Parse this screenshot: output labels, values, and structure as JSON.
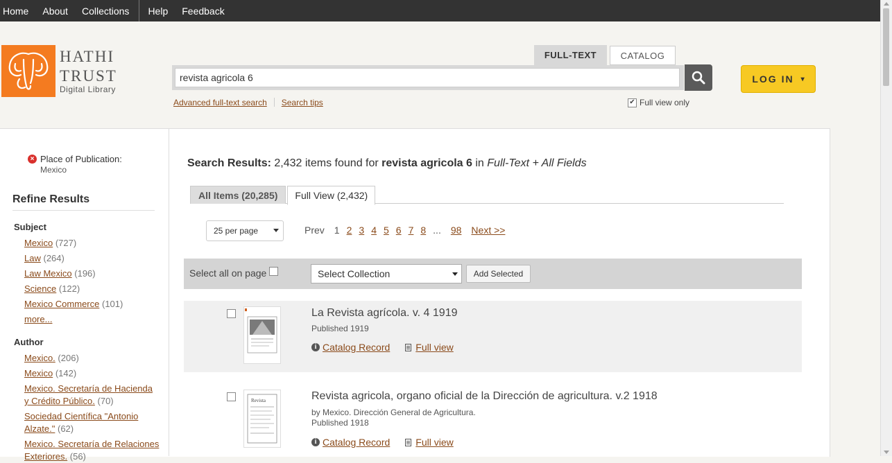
{
  "nav": {
    "items": [
      "Home",
      "About",
      "Collections",
      "Help",
      "Feedback"
    ]
  },
  "logo": {
    "line1": "HATHI",
    "line2": "TRUST",
    "line3": "Digital Library"
  },
  "search": {
    "tab_fulltext": "FULL-TEXT",
    "tab_catalog": "CATALOG",
    "query": "revista agricola 6",
    "advanced_link": "Advanced full-text search",
    "tips_link": "Search tips",
    "full_view_only": "Full view only",
    "full_view_checked": true
  },
  "login": {
    "label": "LOG IN",
    "caret": "▾"
  },
  "filter": {
    "label": "Place of Publication",
    "value": "Mexico"
  },
  "refine": {
    "title": "Refine Results",
    "subject_head": "Subject",
    "subject": [
      {
        "label": "Mexico",
        "count": "(727)"
      },
      {
        "label": "Law",
        "count": "(264)"
      },
      {
        "label": "Law Mexico",
        "count": "(196)"
      },
      {
        "label": "Science",
        "count": "(122)"
      },
      {
        "label": "Mexico Commerce",
        "count": "(101)"
      }
    ],
    "more": "more...",
    "author_head": "Author",
    "author": [
      {
        "label": "Mexico.",
        "count": "(206)"
      },
      {
        "label": "Mexico",
        "count": "(142)"
      },
      {
        "label": "Mexico. Secretaría de Hacienda y Crédito Público.",
        "count": "(70)"
      },
      {
        "label": "Sociedad Científica \"Antonio Alzate.\"",
        "count": "(62)"
      },
      {
        "label": "Mexico. Secretaría de Relaciones Exteriores.",
        "count": "(56)"
      }
    ]
  },
  "results": {
    "heading": "Search Results:",
    "count_text": "2,432 items found for",
    "query_bold": "revista agricola 6",
    "in_text": "in",
    "scope": "Full-Text + All Fields",
    "tab_all": "All Items (20,285)",
    "tab_full": "Full View (2,432)",
    "per_page": "25 per page",
    "pager": {
      "prev": "Prev",
      "current": "1",
      "pages": [
        "2",
        "3",
        "4",
        "5",
        "6",
        "7",
        "8"
      ],
      "ellipsis": "...",
      "last": "98",
      "next": "Next >>"
    },
    "select_all": "Select all on page",
    "collection_select": "Select Collection",
    "add_selected": "Add Selected",
    "items": [
      {
        "title": "La Revista agrícola. v. 4 1919",
        "by": "",
        "published": "Published 1919",
        "catalog": "Catalog Record",
        "full": "Full view"
      },
      {
        "title": "Revista agricola, organo oficial de la Dirección de agricultura. v.2 1918",
        "by": "by Mexico. Dirección General de Agricultura.",
        "published": "Published 1918",
        "catalog": "Catalog Record",
        "full": "Full view"
      }
    ]
  },
  "colors": {
    "topbar": "#333333",
    "logo_orange": "#f47b20",
    "login_yellow": "#f7c923",
    "link": "#8a4a1a"
  }
}
